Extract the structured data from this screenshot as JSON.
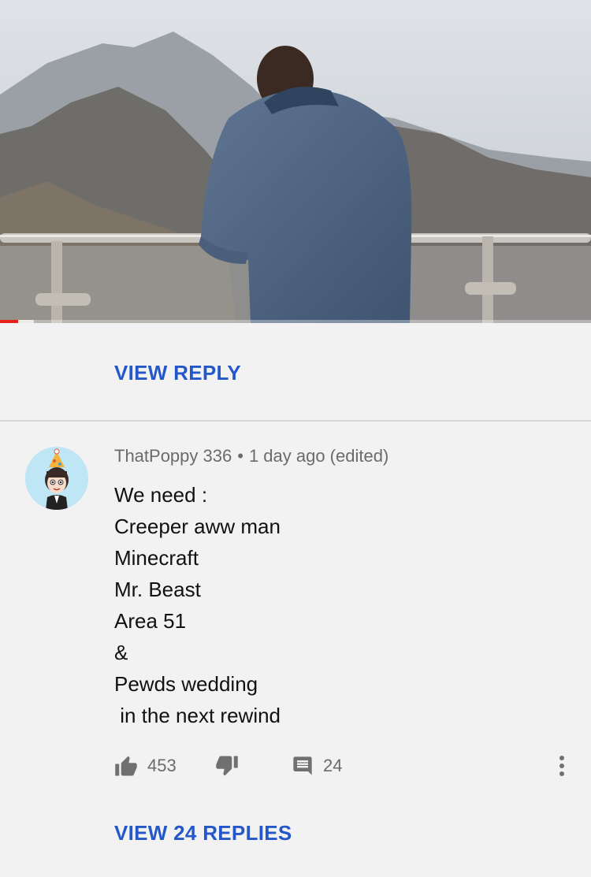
{
  "video": {
    "progress_fraction": 0.03,
    "buffer_fraction": 0.056
  },
  "thread": {
    "view_reply_label": "VIEW REPLY"
  },
  "comment": {
    "author": "ThatPoppy 336",
    "separator": "•",
    "time": "1 day ago (edited)",
    "lines": [
      "We need :",
      "Creeper aww man",
      "Minecraft",
      "Mr. Beast",
      "Area 51",
      "&",
      "Pewds wedding",
      " in the next rewind"
    ],
    "likes": "453",
    "replies_count": "24",
    "view_replies_label": "VIEW 24 REPLIES",
    "icons": {
      "like": "thumb-up-icon",
      "dislike": "thumb-down-icon",
      "reply": "comment-icon",
      "more": "more-vert-icon"
    }
  },
  "colors": {
    "link": "#2458c9",
    "meta": "#6b6b6b",
    "background": "#f2f2f2",
    "progress": "#e62117"
  }
}
